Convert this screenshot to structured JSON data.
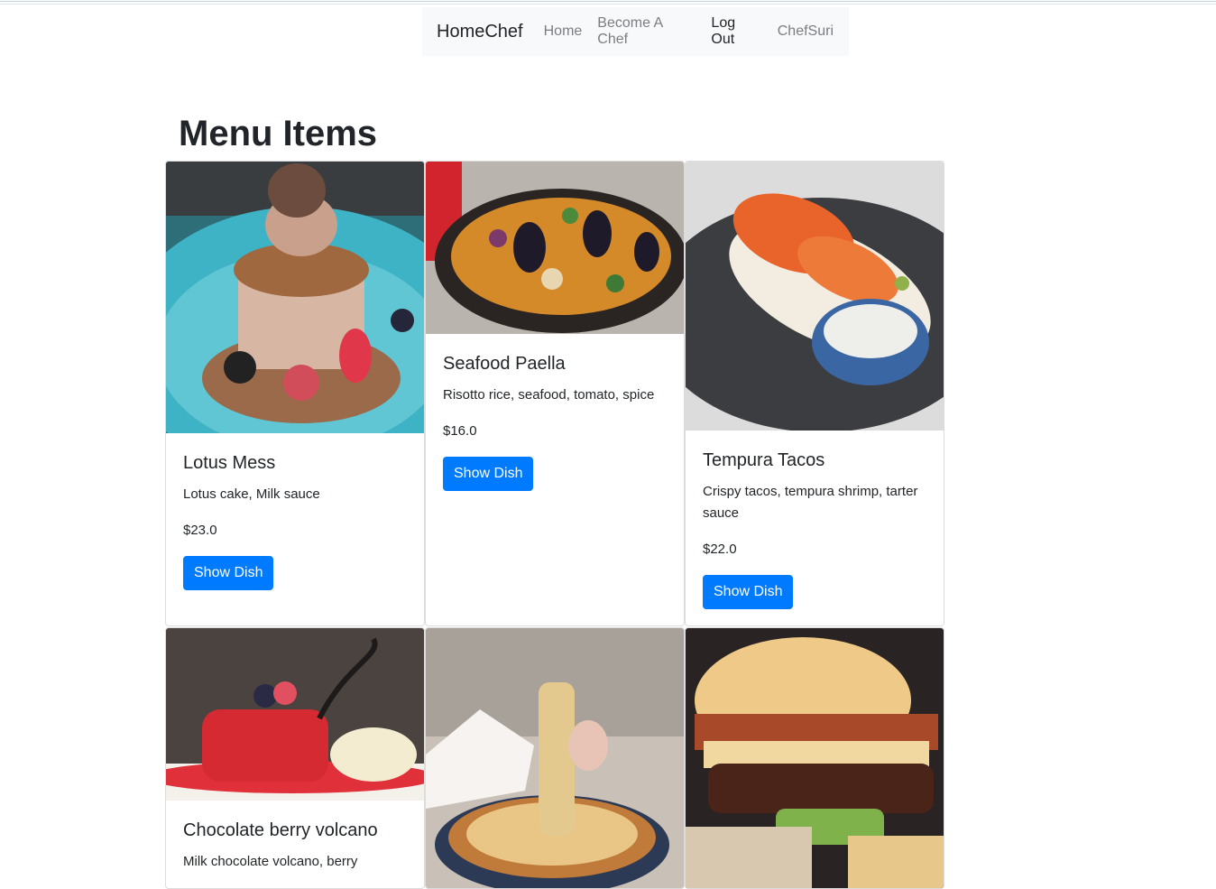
{
  "navbar": {
    "brand": "HomeChef",
    "links": [
      "Home",
      "Become A Chef",
      "Log Out",
      "ChefSuri"
    ]
  },
  "page": {
    "title": "Menu Items"
  },
  "colors": {
    "primary": "#007bff",
    "navbar_bg": "#f8f9fa"
  },
  "menu_items": [
    {
      "name": "Lotus Mess",
      "description": "Lotus cake, Milk sauce",
      "price": "$23.0",
      "button": "Show Dish"
    },
    {
      "name": "Seafood Paella",
      "description": "Risotto rice, seafood, tomato, spice",
      "price": "$16.0",
      "button": "Show Dish"
    },
    {
      "name": "Tempura Tacos",
      "description": "Crispy tacos, tempura shrimp, tarter sauce",
      "price": "$22.0",
      "button": "Show Dish"
    },
    {
      "name": "Chocolate berry volcano",
      "description": "Milk chocolate volcano, berry"
    }
  ]
}
